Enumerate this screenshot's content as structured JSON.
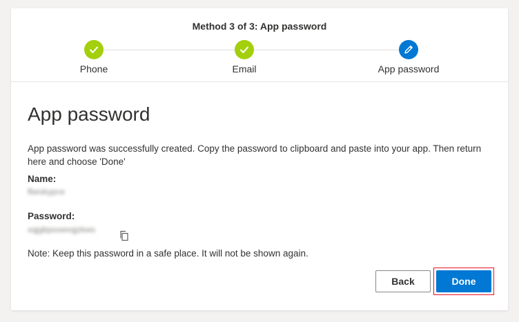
{
  "header": {
    "title": "Method 3 of 3: App password"
  },
  "steps": [
    {
      "label": "Phone",
      "state": "done",
      "icon": "check-icon"
    },
    {
      "label": "Email",
      "state": "done",
      "icon": "check-icon"
    },
    {
      "label": "App password",
      "state": "current",
      "icon": "pencil-icon"
    }
  ],
  "colors": {
    "done": "#a4cf0c",
    "current": "#0078d4",
    "primary_button": "#0078d4",
    "focus_outline": "#e81123"
  },
  "main": {
    "heading": "App password",
    "description": "App password was successfully created. Copy the password to clipboard and paste into your app. Then return here and choose 'Done'",
    "name_label": "Name:",
    "name_value": "fbeskypce",
    "password_label": "Password:",
    "password_value": "xqjgbpsxwvqjzkws",
    "copy_icon": "copy-icon",
    "note": "Note: Keep this password in a safe place. It will not be shown again."
  },
  "buttons": {
    "back": "Back",
    "done": "Done"
  }
}
